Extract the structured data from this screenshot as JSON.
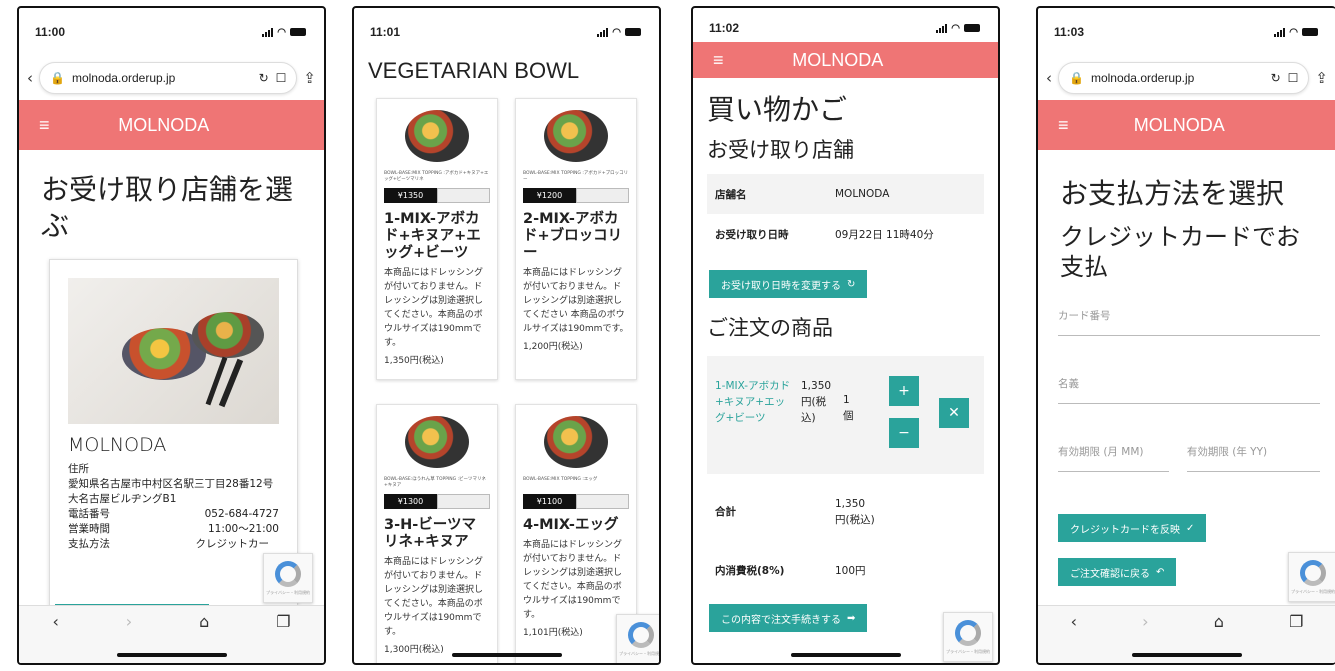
{
  "p1": {
    "time": "11:00",
    "url": "molnoda.orderup.jp",
    "brand": "MOLNODA",
    "title": "お受け取り店舗を選ぶ",
    "store": "MOLNODA",
    "addr_label": "住所",
    "addr1": "愛知県名古屋市中村区名駅三丁目28番12号",
    "addr2": "大名古屋ビルヂングB1",
    "tel_label": "電話番号",
    "tel": "052-684-4727",
    "hours_label": "営業時間",
    "hours": "11:00〜21:00",
    "pay_label": "支払方法",
    "pay": "クレジットカー"
  },
  "p2": {
    "time": "11:01",
    "title": "VEGETARIAN BOWL",
    "products": [
      {
        "top": "BOWL-BASE:MIX TOPPING :アボカド+キヌア+エッグ+ビーツマリネ",
        "price": "¥1350",
        "name": "1-MIX-アボカド+キヌア+エッグ+ビーツ",
        "desc": "本商品にはドレッシングが付いておりません。ドレッシングは別途選択してください。本商品のボウルサイズは190mmです。",
        "yen": "1,350円(税込)"
      },
      {
        "top": "BOWL-BASE:MIX TOPPING :アボカド+ブロッコリー",
        "price": "¥1200",
        "name": "2-MIX-アボカド+ブロッコリー",
        "desc": "本商品にはドレッシングが付いておりません。ドレッシングは別途選択してください 本商品のボウルサイズは190mmです。",
        "yen": "1,200円(税込)"
      },
      {
        "top": "BOWL-BASE:ほうれん草 TOPPING :ビーツマリネ+キヌア",
        "price": "¥1300",
        "name": "3-H-ビーツマリネ+キヌア",
        "desc": "本商品にはドレッシングが付いておりません。ドレッシングは別途選択してください。本商品のボウルサイズは190mmです。",
        "yen": "1,300円(税込)"
      },
      {
        "top": "BOWL-BASE:MIX TOPPING :エッグ",
        "price": "¥1100",
        "name": "4-MIX-エッグ",
        "desc": "本商品にはドレッシングが付いておりません。ドレッシングは別途選択してください。本商品のボウルサイズは190mmです。",
        "yen": "1,101円(税込)"
      }
    ]
  },
  "p3": {
    "time": "11:02",
    "brand": "MOLNODA",
    "title": "買い物かご",
    "sub": "お受け取り店舗",
    "store_k": "店舗名",
    "store_v": "MOLNODA",
    "date_k": "お受け取り日時",
    "date_v": "09月22日 11時40分",
    "change_btn": "お受け取り日時を変更する",
    "orders": "ご注文の商品",
    "item_name": "1-MIX-アボカド+キヌア+エッグ+ビーツ",
    "item_price": "1,350円(税込)",
    "qty": "1",
    "qty_unit": "個",
    "plus": "+",
    "minus": "−",
    "total_k": "合計",
    "total_v": "1,350円(税込)",
    "tax_k": "内消費税(8%)",
    "tax_v": "100円",
    "proceed": "この内容で注文手続きする"
  },
  "p4": {
    "time": "11:03",
    "url": "molnoda.orderup.jp",
    "brand": "MOLNODA",
    "title": "お支払方法を選択",
    "sub": "クレジットカードでお支払",
    "card_ph": "カード番号",
    "name_ph": "名義",
    "mm_ph": "有効期限 (月 MM)",
    "yy_ph": "有効期限 (年 YY)",
    "apply": "クレジットカードを反映",
    "back": "ご注文確認に戻る"
  }
}
